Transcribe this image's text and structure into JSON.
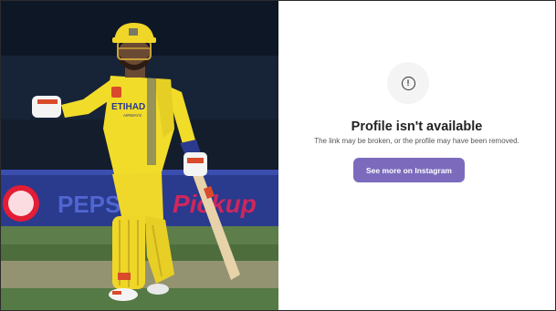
{
  "photo": {
    "alt_icon": "cricketer-photo",
    "jersey_sponsor": "ETIHAD",
    "jersey_sponsor_sub": "AIRWAYS",
    "board_text_1": "PEPSI",
    "board_text_2": "Pickup"
  },
  "profile_error": {
    "icon": "alert-circle-icon",
    "title": "Profile isn't available",
    "subtitle": "The link may be broken, or the profile may have been removed.",
    "cta_label": "See more on Instagram",
    "cta_color": "#7c6bbd"
  },
  "colors": {
    "jersey": "#f2dc2a",
    "panel_bg": "#ffffff"
  }
}
